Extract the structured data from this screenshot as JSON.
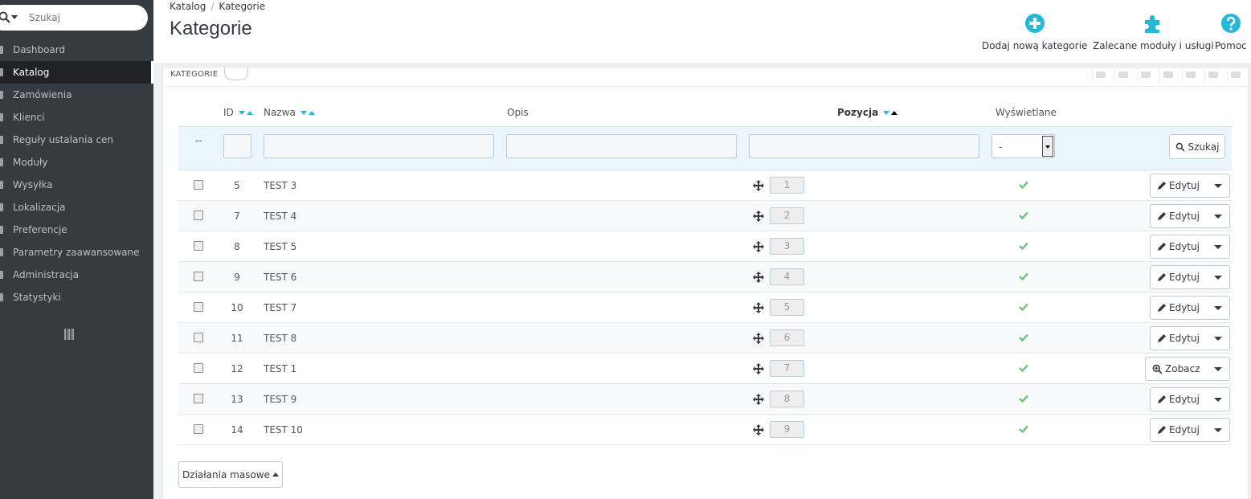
{
  "sidebar": {
    "search_placeholder": "Szukaj",
    "items": [
      {
        "label": "Dashboard",
        "active": false
      },
      {
        "label": "Katalog",
        "active": true
      },
      {
        "label": "Zamówienia",
        "active": false
      },
      {
        "label": "Klienci",
        "active": false
      },
      {
        "label": "Reguły ustalania cen",
        "active": false
      },
      {
        "label": "Moduły",
        "active": false
      },
      {
        "label": "Wysyłka",
        "active": false
      },
      {
        "label": "Lokalizacja",
        "active": false
      },
      {
        "label": "Preferencje",
        "active": false
      },
      {
        "label": "Parametry zaawansowane",
        "active": false
      },
      {
        "label": "Administracja",
        "active": false
      },
      {
        "label": "Statystyki",
        "active": false
      }
    ]
  },
  "header": {
    "breadcrumb": [
      "Katalog",
      "Kategorie"
    ],
    "breadcrumb_separator": "/",
    "title": "Kategorie",
    "toolbar": {
      "add": "Dodaj nową kategorie",
      "modules": "Zalecane moduły i usługi",
      "help": "Pomoc"
    }
  },
  "panel": {
    "heading": "KATEGORIE",
    "columns": {
      "id": "ID",
      "name": "Nazwa",
      "description": "Opis",
      "position": "Pozycja",
      "displayed": "Wyświetlane"
    },
    "filters": {
      "dash": "--",
      "select_value": "-",
      "search_button": "Szukaj"
    },
    "rows": [
      {
        "id": "5",
        "name": "TEST 3",
        "position": "1",
        "action": "Edytuj"
      },
      {
        "id": "7",
        "name": "TEST 4",
        "position": "2",
        "action": "Edytuj"
      },
      {
        "id": "8",
        "name": "TEST 5",
        "position": "3",
        "action": "Edytuj"
      },
      {
        "id": "9",
        "name": "TEST 6",
        "position": "4",
        "action": "Edytuj"
      },
      {
        "id": "10",
        "name": "TEST 7",
        "position": "5",
        "action": "Edytuj"
      },
      {
        "id": "11",
        "name": "TEST 8",
        "position": "6",
        "action": "Edytuj"
      },
      {
        "id": "12",
        "name": "TEST 1",
        "position": "7",
        "action": "Zobacz"
      },
      {
        "id": "13",
        "name": "TEST 9",
        "position": "8",
        "action": "Edytuj"
      },
      {
        "id": "14",
        "name": "TEST 10",
        "position": "9",
        "action": "Edytuj"
      }
    ],
    "bulk_actions": "Działania masowe"
  },
  "colors": {
    "sidebar_bg": "#363a41",
    "accent": "#25b9d7",
    "check": "#72c279"
  }
}
